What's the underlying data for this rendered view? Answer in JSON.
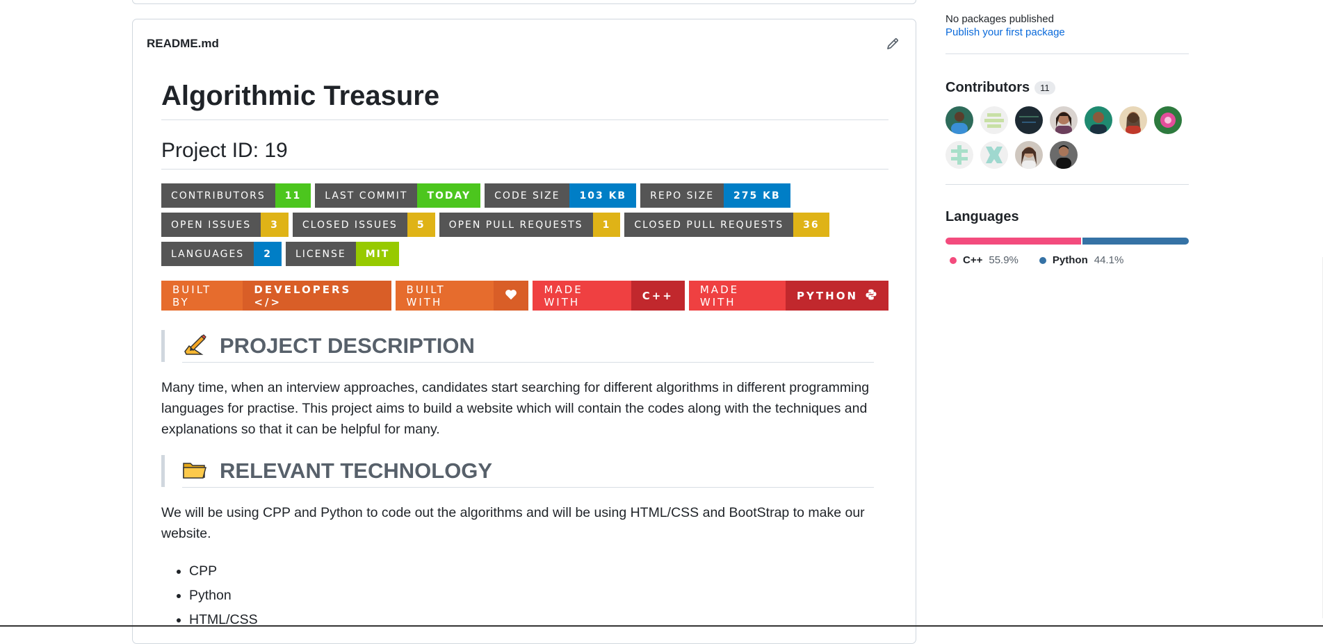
{
  "readme": {
    "filename": "README.md",
    "title": "Algorithmic Treasure",
    "project_id": "Project ID: 19",
    "badges_row1": [
      {
        "label": "CONTRIBUTORS",
        "value": "11",
        "color": "#4cc61e"
      },
      {
        "label": "LAST COMMIT",
        "value": "TODAY",
        "color": "#4cc61e"
      },
      {
        "label": "CODE SIZE",
        "value": "103 KB",
        "color": "#007ec6"
      },
      {
        "label": "REPO SIZE",
        "value": "275 KB",
        "color": "#007ec6"
      }
    ],
    "badges_row2": [
      {
        "label": "OPEN ISSUES",
        "value": "3",
        "color": "#dfb317"
      },
      {
        "label": "CLOSED ISSUES",
        "value": "5",
        "color": "#dfb317"
      },
      {
        "label": "OPEN PULL REQUESTS",
        "value": "1",
        "color": "#dfb317"
      },
      {
        "label": "CLOSED PULL REQUESTS",
        "value": "36",
        "color": "#dfb317"
      }
    ],
    "badges_row3": [
      {
        "label": "LANGUAGES",
        "value": "2",
        "color": "#007ec6"
      },
      {
        "label": "LICENSE",
        "value": "MIT",
        "color": "#97ca00"
      }
    ],
    "big_badges": [
      {
        "left": "BUILT BY",
        "right": "DEVELOPERS </>",
        "left_color": "#e66c2d",
        "right_color": "#d95e27"
      },
      {
        "left": "BUILT WITH",
        "right": "",
        "left_color": "#e66c2d",
        "right_color": "#d95e27",
        "icon": "heart-icon"
      },
      {
        "left": "MADE WITH",
        "right": "C++",
        "left_color": "#ef4041",
        "right_color": "#c1282d"
      },
      {
        "left": "MADE WITH",
        "right": "PYTHON",
        "left_color": "#ef4041",
        "right_color": "#c1282d",
        "icon": "python-icon"
      }
    ],
    "section1_heading": "PROJECT DESCRIPTION",
    "section1_icon": "writing-hand-icon",
    "section1_body": "Many time, when an interview approaches, candidates start searching for different algorithms in different programming languages for practise. This project aims to build a website which will contain the codes along with the techniques and explanations so that it can be helpful for many.",
    "section2_heading": "RELEVANT TECHNOLOGY",
    "section2_icon": "folder-icon",
    "section2_body": "We will be using CPP and Python to code out the algorithms and will be using HTML/CSS and BootStrap to make our website.",
    "tech_list": [
      "CPP",
      "Python",
      "HTML/CSS"
    ]
  },
  "sidebar": {
    "packages_text": "No packages published",
    "packages_link": "Publish your first package",
    "contributors_title": "Contributors",
    "contributors_count": "11",
    "languages_title": "Languages",
    "languages": [
      {
        "name": "C++",
        "percent": "55.9%",
        "value": 55.9,
        "color": "#f34b7d"
      },
      {
        "name": "Python",
        "percent": "44.1%",
        "value": 44.1,
        "color": "#3572a5"
      }
    ]
  }
}
